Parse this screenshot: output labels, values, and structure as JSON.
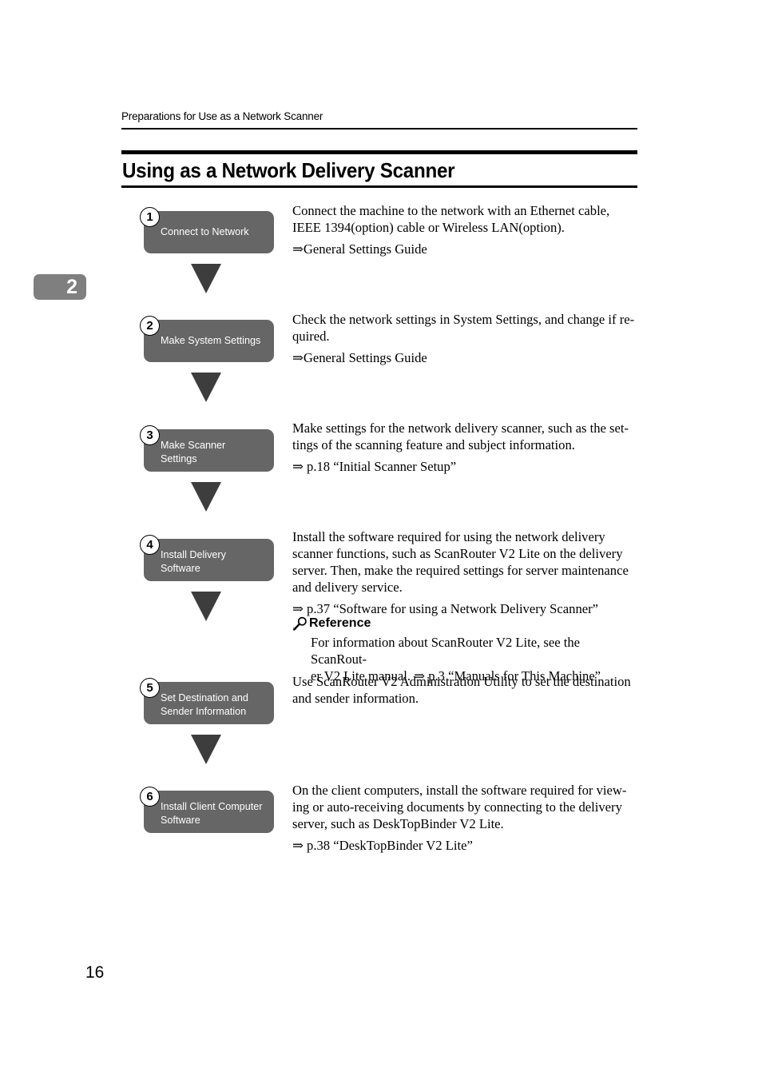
{
  "page": {
    "running_header": "Preparations for Use as a Network Scanner",
    "chapter_marker": "2",
    "page_number": "16",
    "section_title": "Using as a Network Delivery Scanner"
  },
  "flow": {
    "steps": [
      {
        "number": "1",
        "box_label": "Connect to Network",
        "lines": [
          "Connect the machine to the network with an Ethernet cable,",
          "IEEE 1394(option) cable or Wireless LAN(option)."
        ],
        "reference": "⇒General Settings Guide"
      },
      {
        "number": "2",
        "box_label": "Make System Settings",
        "lines": [
          "Check the network settings in System Settings, and change if re-",
          "quired."
        ],
        "reference": "⇒General Settings Guide"
      },
      {
        "number": "3",
        "box_label_line1": "Make Scanner",
        "box_label_line2": "Settings",
        "lines": [
          "Make settings for the network delivery scanner, such as the set-",
          "tings of the scanning feature and subject information."
        ],
        "reference": "⇒ p.18 “Initial Scanner Setup”"
      },
      {
        "number": "4",
        "box_label_line1": "Install Delivery",
        "box_label_line2": "Software",
        "lines": [
          "Install the software required for using the network delivery",
          "scanner functions, such as ScanRouter V2 Lite on the delivery",
          "server. Then, make the required settings for server maintenance",
          "and delivery service."
        ],
        "reference": "⇒ p.37 “Software for using a Network Delivery Scanner”"
      },
      {
        "number": "5",
        "box_label_line1": "Set Destination and",
        "box_label_line2": "Sender Information",
        "lines": [
          "Use ScanRouter V2 Administration Utility to set the destination",
          "and sender information."
        ],
        "reference": ""
      },
      {
        "number": "6",
        "box_label_line1": "Install Client Computer",
        "box_label_line2": "Software",
        "lines": [
          "On the client computers, install the software required for view-",
          "ing or auto-receiving documents by connecting to the delivery",
          "server, such as DeskTopBinder V2 Lite."
        ],
        "reference": "⇒ p.38 “DeskTopBinder V2 Lite”"
      }
    ]
  },
  "reference_note": {
    "icon": "magnifier-icon",
    "heading": "Reference",
    "lines": [
      "For information about ScanRouter V2 Lite, see the ScanRout-",
      "er V2 Lite manual. ⇒ p.3 “Manuals for This Machine”"
    ]
  }
}
